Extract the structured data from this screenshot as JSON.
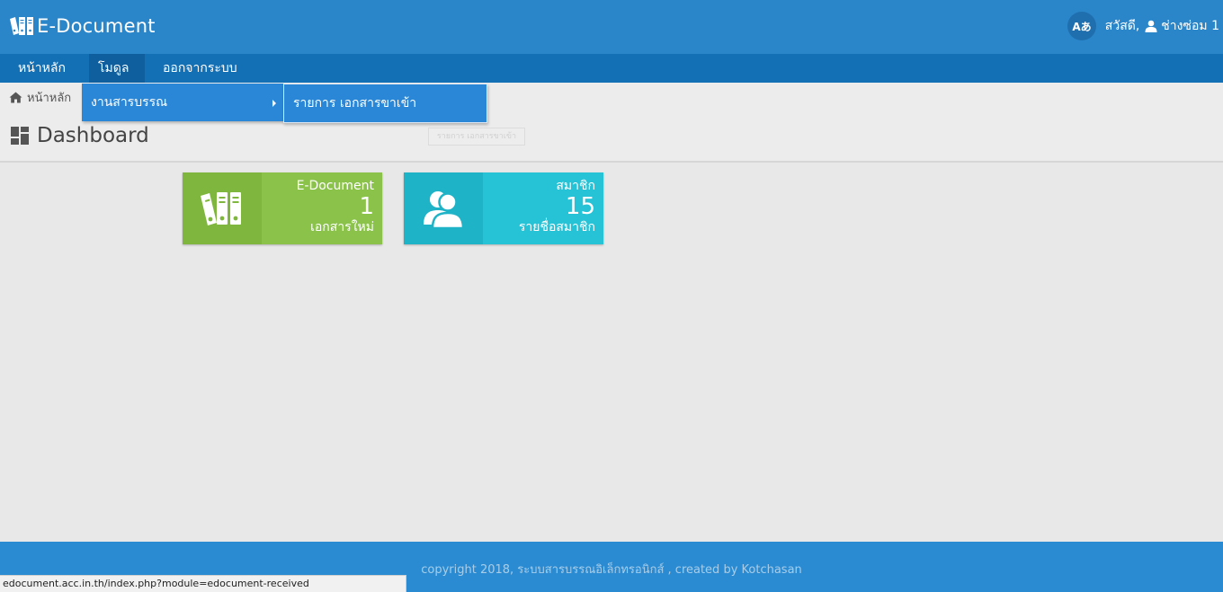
{
  "app": {
    "title": "E-Document"
  },
  "header": {
    "lang_label": "Aあ",
    "greeting": "สวัสดี,",
    "user_name": "ช่างซ่อม 1"
  },
  "nav": {
    "home": "หน้าหลัก",
    "module": "โมดูล",
    "logout": "ออกจากระบบ"
  },
  "dropdown": {
    "item": "งานสารบรรณ",
    "submenu_item": "รายการ เอกสารขาเข้า"
  },
  "ghost_tooltip": "รายการ เอกสารขาเข้า",
  "breadcrumb": {
    "home": "หน้าหลัก"
  },
  "page": {
    "title": "Dashboard"
  },
  "cards": [
    {
      "label": "E-Document",
      "count": "1",
      "sub": "เอกสารใหม่",
      "icon": "binders-icon",
      "color": "#8bc34a"
    },
    {
      "label": "สมาชิก",
      "count": "15",
      "sub": "รายชื่อสมาชิก",
      "icon": "users-icon",
      "color": "#26c2d6"
    }
  ],
  "footer": {
    "text": "copyright 2018, ระบบสารบรรณอิเล็กทรอนิกส์ , created by Kotchasan"
  },
  "statusbar": {
    "url": "edocument.acc.in.th/index.php?module=edocument-received"
  },
  "colors": {
    "header": "#2a86c9",
    "nav": "#1470b5",
    "dropdown": "#2a86d6",
    "footer": "#2a8bd2"
  }
}
